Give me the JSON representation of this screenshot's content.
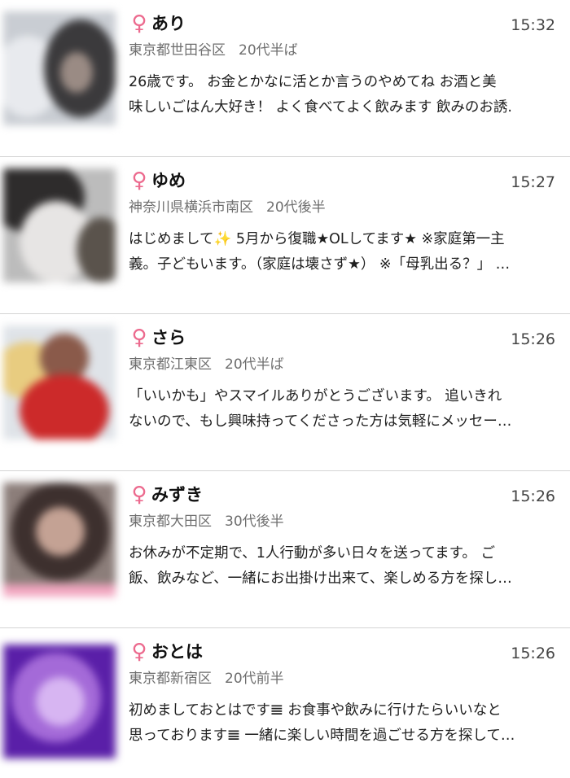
{
  "colors": {
    "female_icon": "#ec6a8e",
    "divider": "#d4d4d4",
    "meta_text": "#6e6e6e"
  },
  "icons": {
    "gender": "female-symbol-icon"
  },
  "gender_symbol": "♀",
  "messages": [
    {
      "name": "あり",
      "time": "15:32",
      "location": "東京都世田谷区",
      "age": "20代半ば",
      "preview_line1": "26歳です。 お金とかなに活とか言うのやめてね お酒と美",
      "preview_line2": "味しいごはん大好き！ よく食べてよく飲みます 飲みのお誘."
    },
    {
      "name": "ゆめ",
      "time": "15:27",
      "location": "神奈川県横浜市南区",
      "age": "20代後半",
      "preview_line1": "はじめまして✨ 5月から復職★OLしてます★ ※家庭第一主",
      "preview_line2": "義。子どもいます。（家庭は壊さず★） ※「母乳出る？」 …"
    },
    {
      "name": "さら",
      "time": "15:26",
      "location": "東京都江東区",
      "age": "20代半ば",
      "preview_line1": "「いいかも」やスマイルありがとうございます。 追いきれ",
      "preview_line2": "ないので、もし興味持ってくださった方は気軽にメッセー…"
    },
    {
      "name": "みずき",
      "time": "15:26",
      "location": "東京都大田区",
      "age": "30代後半",
      "preview_line1": "お休みが不定期で、1人行動が多い日々を送ってます。 ご",
      "preview_line2": "飯、飲みなど、一緒にお出掛け出来て、楽しめる方を探し…"
    },
    {
      "name": "おとは",
      "time": "15:26",
      "location": "東京都新宿区",
      "age": "20代前半",
      "preview_line1": "初めましておとはです𝌆 お食事や飲みに行けたらいいなと",
      "preview_line2": "思っております𝌆 一緒に楽しい時間を過ごせる方を探して…"
    }
  ]
}
